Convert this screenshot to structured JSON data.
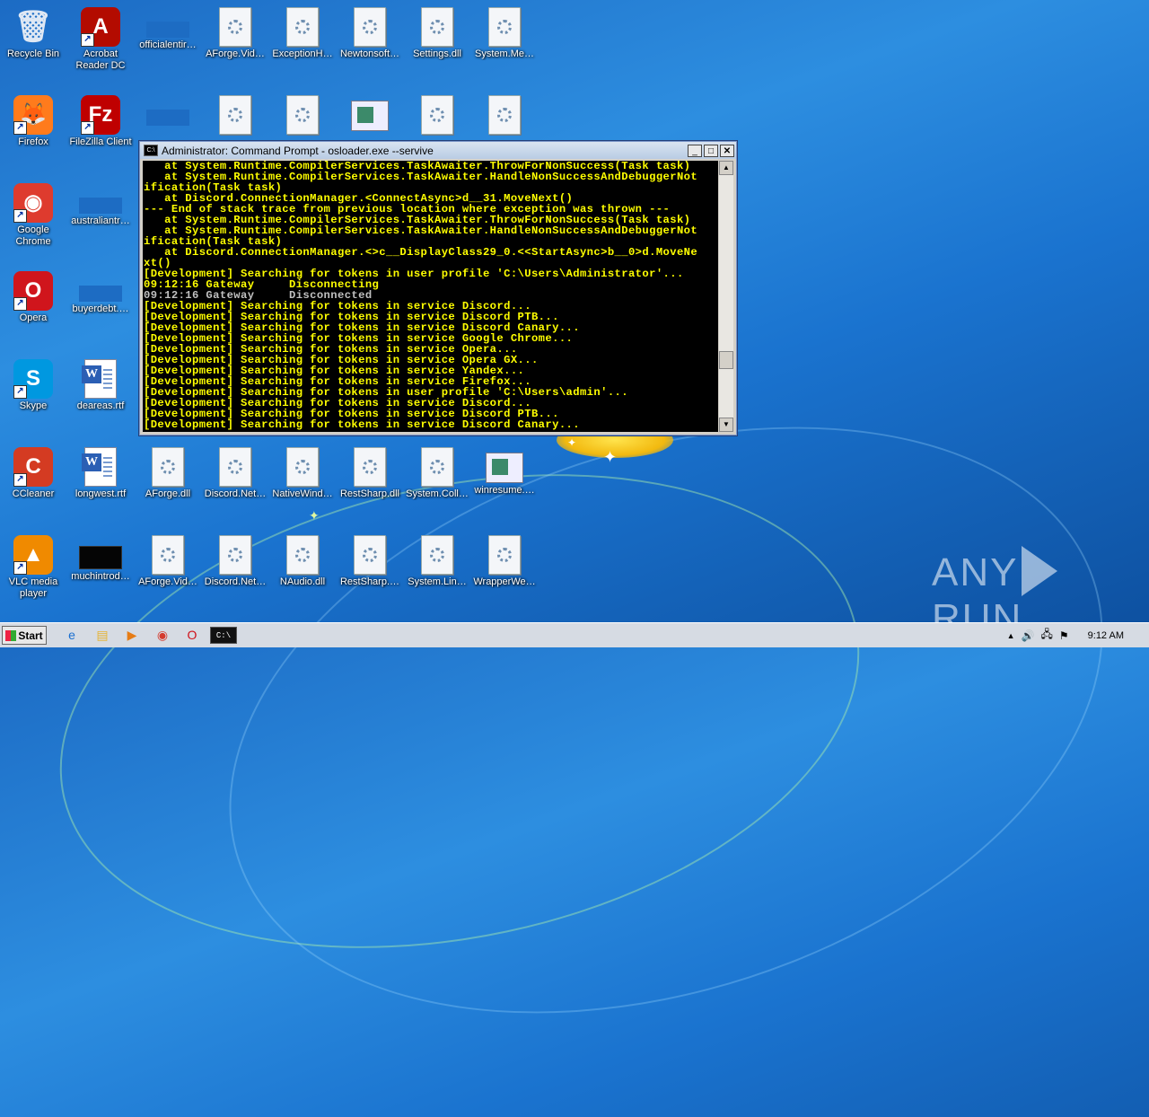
{
  "desktop": {
    "icons": [
      {
        "label": "Recycle Bin",
        "glyph": "🗑",
        "color": "#cfd8e6",
        "kind": "app",
        "shortcut": false
      },
      {
        "label": "Acrobat Reader DC",
        "glyph": "A",
        "color": "#b30b00",
        "kind": "app",
        "shortcut": true
      },
      {
        "label": "officialentir…",
        "kind": "blank"
      },
      {
        "label": "AForge.Vid…",
        "kind": "dll"
      },
      {
        "label": "ExceptionH…",
        "kind": "dll"
      },
      {
        "label": "Newtonsoft…",
        "kind": "dll"
      },
      {
        "label": "Settings.dll",
        "kind": "dll"
      },
      {
        "label": "System.Me…",
        "kind": "dll"
      },
      {
        "label": "Firefox",
        "glyph": "🦊",
        "color": "#ff7b1c",
        "kind": "app",
        "shortcut": true
      },
      {
        "label": "FileZilla Client",
        "glyph": "Fz",
        "color": "#bf0000",
        "kind": "app",
        "shortcut": true
      },
      {
        "label": "",
        "kind": "blank"
      },
      {
        "label": "",
        "kind": "dll"
      },
      {
        "label": "",
        "kind": "dll"
      },
      {
        "label": "",
        "kind": "winimg"
      },
      {
        "label": "",
        "kind": "dll"
      },
      {
        "label": "",
        "kind": "dll"
      },
      {
        "label": "Google Chrome",
        "glyph": "◉",
        "color": "#de3b2e",
        "kind": "app",
        "shortcut": true
      },
      {
        "label": "australiantr…",
        "kind": "blank"
      },
      {
        "label": "Opera",
        "glyph": "O",
        "color": "#d0151c",
        "kind": "app",
        "shortcut": true
      },
      {
        "label": "buyerdebt.…",
        "kind": "blank"
      },
      {
        "label": "Skype",
        "glyph": "S",
        "color": "#0098e0",
        "kind": "app",
        "shortcut": true
      },
      {
        "label": "deareas.rtf",
        "kind": "rtf"
      },
      {
        "label": "CCleaner",
        "glyph": "C",
        "color": "#d43b22",
        "kind": "app",
        "shortcut": true
      },
      {
        "label": "longwest.rtf",
        "kind": "rtf"
      },
      {
        "label": "AForge.dll",
        "kind": "dll"
      },
      {
        "label": "Discord.Net…",
        "kind": "dll"
      },
      {
        "label": "NativeWind…",
        "kind": "dll"
      },
      {
        "label": "RestSharp.dll",
        "kind": "dll"
      },
      {
        "label": "System.Coll…",
        "kind": "dll"
      },
      {
        "label": "winresume.…",
        "kind": "winimg"
      },
      {
        "label": "VLC media player",
        "glyph": "▲",
        "color": "#f08a00",
        "kind": "app",
        "shortcut": true
      },
      {
        "label": "muchintrod…",
        "kind": "black"
      },
      {
        "label": "AForge.Vid…",
        "kind": "dll"
      },
      {
        "label": "Discord.Net…",
        "kind": "dll"
      },
      {
        "label": "NAudio.dll",
        "kind": "dll"
      },
      {
        "label": "RestSharp.…",
        "kind": "dll"
      },
      {
        "label": "System.Lin…",
        "kind": "dll"
      },
      {
        "label": "WrapperWe…",
        "kind": "dll"
      }
    ]
  },
  "cmd": {
    "title": "Administrator: Command Prompt - osloader.exe  --servive",
    "minimize": "_",
    "maximize": "□",
    "close": "✕",
    "lines": [
      {
        "t": "   at System.Runtime.CompilerServices.TaskAwaiter.ThrowForNonSuccess(Task task)",
        "c": "y"
      },
      {
        "t": "   at System.Runtime.CompilerServices.TaskAwaiter.HandleNonSuccessAndDebuggerNot",
        "c": "y"
      },
      {
        "t": "ification(Task task)",
        "c": "y"
      },
      {
        "t": "   at Discord.ConnectionManager.<ConnectAsync>d__31.MoveNext()",
        "c": "y"
      },
      {
        "t": "--- End of stack trace from previous location where exception was thrown ---",
        "c": "y"
      },
      {
        "t": "   at System.Runtime.CompilerServices.TaskAwaiter.ThrowForNonSuccess(Task task)",
        "c": "y"
      },
      {
        "t": "   at System.Runtime.CompilerServices.TaskAwaiter.HandleNonSuccessAndDebuggerNot",
        "c": "y"
      },
      {
        "t": "ification(Task task)",
        "c": "y"
      },
      {
        "t": "   at Discord.ConnectionManager.<>c__DisplayClass29_0.<<StartAsync>b__0>d.MoveNe",
        "c": "y"
      },
      {
        "t": "xt()",
        "c": "y"
      },
      {
        "t": "[Development] Searching for tokens in user profile 'C:\\Users\\Administrator'...",
        "c": "y"
      },
      {
        "t": "09:12:16 Gateway     Disconnecting",
        "c": "y"
      },
      {
        "t": "09:12:16 Gateway     Disconnected",
        "c": "g"
      },
      {
        "t": "[Development] Searching for tokens in service Discord...",
        "c": "y"
      },
      {
        "t": "[Development] Searching for tokens in service Discord PTB...",
        "c": "y"
      },
      {
        "t": "[Development] Searching for tokens in service Discord Canary...",
        "c": "y"
      },
      {
        "t": "[Development] Searching for tokens in service Google Chrome...",
        "c": "y"
      },
      {
        "t": "[Development] Searching for tokens in service Opera...",
        "c": "y"
      },
      {
        "t": "[Development] Searching for tokens in service Opera GX...",
        "c": "y"
      },
      {
        "t": "[Development] Searching for tokens in service Yandex...",
        "c": "y"
      },
      {
        "t": "[Development] Searching for tokens in service Firefox...",
        "c": "y"
      },
      {
        "t": "[Development] Searching for tokens in user profile 'C:\\Users\\admin'...",
        "c": "y"
      },
      {
        "t": "[Development] Searching for tokens in service Discord...",
        "c": "y"
      },
      {
        "t": "[Development] Searching for tokens in service Discord PTB...",
        "c": "y"
      },
      {
        "t": "[Development] Searching for tokens in service Discord Canary...",
        "c": "y"
      }
    ]
  },
  "taskbar": {
    "start_label": "Start",
    "pinned": [
      {
        "name": "ie",
        "glyph": "e",
        "color": "#1a6fd0"
      },
      {
        "name": "explorer",
        "glyph": "▤",
        "color": "#e6b333"
      },
      {
        "name": "media-player",
        "glyph": "▶",
        "color": "#e67c15"
      },
      {
        "name": "chrome",
        "glyph": "◉",
        "color": "#d43b2e"
      },
      {
        "name": "opera",
        "glyph": "O",
        "color": "#cf1119"
      },
      {
        "name": "cmd",
        "glyph": "C:\\",
        "color": "#000000"
      }
    ],
    "tray": {
      "show_hidden": "▲",
      "volume": "🔊",
      "network": "🖧",
      "flag": "⚑",
      "clock": "9:12 AM"
    }
  },
  "watermark": {
    "left": "ANY",
    "right": "RUN"
  }
}
